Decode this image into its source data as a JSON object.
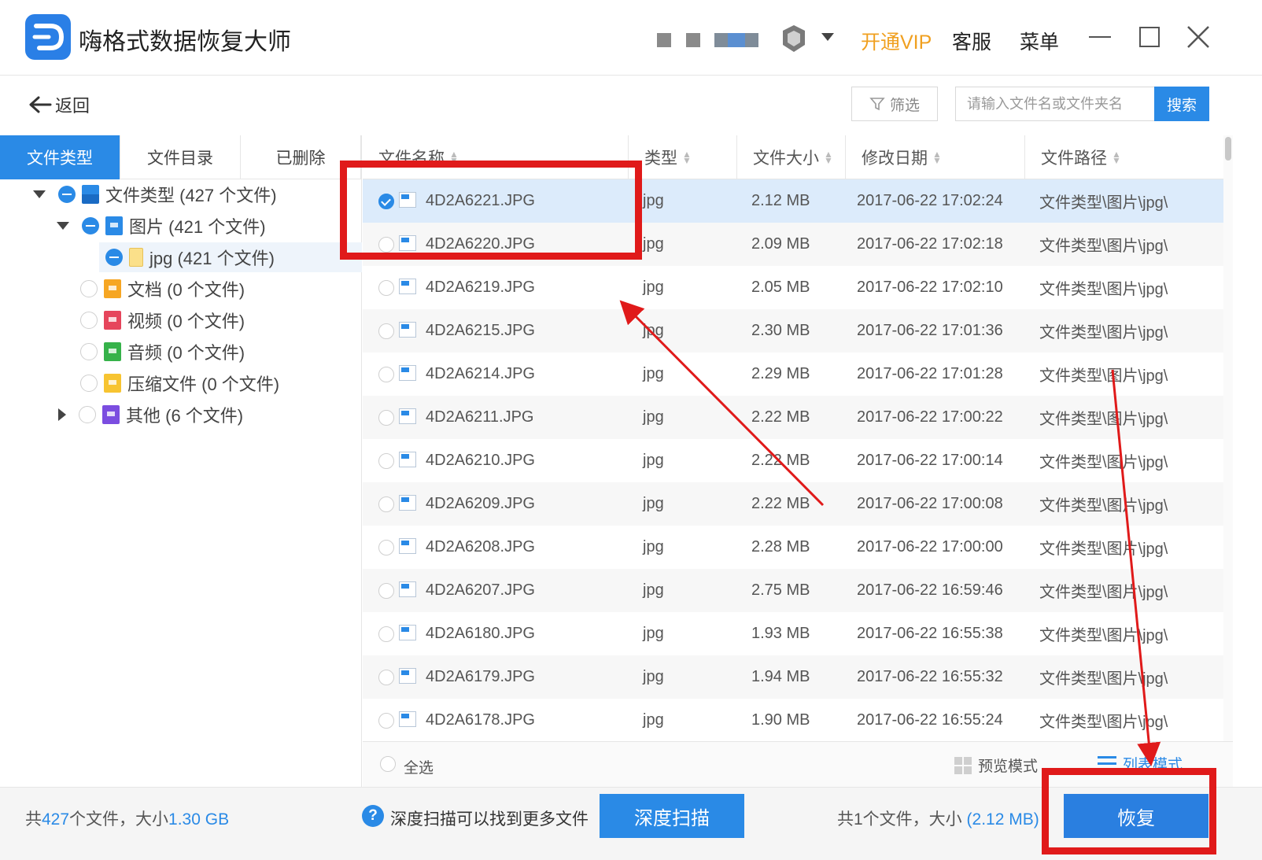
{
  "app": {
    "title": "嗨格式数据恢复大师",
    "vip_label": "开通VIP",
    "service_label": "客服",
    "menu_label": "菜单"
  },
  "toolbar": {
    "back_label": "返回",
    "filter_label": "筛选",
    "search_placeholder": "请输入文件名或文件夹名",
    "search_label": "搜索"
  },
  "tabs": [
    {
      "label": "文件类型",
      "active": true
    },
    {
      "label": "文件目录",
      "active": false
    },
    {
      "label": "已删除",
      "active": false
    }
  ],
  "tree": [
    {
      "label": "文件类型 (427 个文件)"
    },
    {
      "label": "图片 (421 个文件)"
    },
    {
      "label": "jpg (421 个文件)"
    },
    {
      "label": "文档 (0 个文件)"
    },
    {
      "label": "视频 (0 个文件)"
    },
    {
      "label": "音频 (0 个文件)"
    },
    {
      "label": "压缩文件 (0 个文件)"
    },
    {
      "label": "其他 (6 个文件)"
    }
  ],
  "table": {
    "columns": [
      "文件名称",
      "类型",
      "文件大小",
      "修改日期",
      "文件路径"
    ],
    "rows": [
      {
        "name": "4D2A6221.JPG",
        "type": "jpg",
        "size": "2.12 MB",
        "date": "2017-06-22 17:02:24",
        "path": "文件类型\\图片\\jpg\\",
        "checked": true
      },
      {
        "name": "4D2A6220.JPG",
        "type": "jpg",
        "size": "2.09 MB",
        "date": "2017-06-22 17:02:18",
        "path": "文件类型\\图片\\jpg\\",
        "checked": false
      },
      {
        "name": "4D2A6219.JPG",
        "type": "jpg",
        "size": "2.05 MB",
        "date": "2017-06-22 17:02:10",
        "path": "文件类型\\图片\\jpg\\",
        "checked": false
      },
      {
        "name": "4D2A6215.JPG",
        "type": "jpg",
        "size": "2.30 MB",
        "date": "2017-06-22 17:01:36",
        "path": "文件类型\\图片\\jpg\\",
        "checked": false
      },
      {
        "name": "4D2A6214.JPG",
        "type": "jpg",
        "size": "2.29 MB",
        "date": "2017-06-22 17:01:28",
        "path": "文件类型\\图片\\jpg\\",
        "checked": false
      },
      {
        "name": "4D2A6211.JPG",
        "type": "jpg",
        "size": "2.22 MB",
        "date": "2017-06-22 17:00:22",
        "path": "文件类型\\图片\\jpg\\",
        "checked": false
      },
      {
        "name": "4D2A6210.JPG",
        "type": "jpg",
        "size": "2.22 MB",
        "date": "2017-06-22 17:00:14",
        "path": "文件类型\\图片\\jpg\\",
        "checked": false
      },
      {
        "name": "4D2A6209.JPG",
        "type": "jpg",
        "size": "2.22 MB",
        "date": "2017-06-22 17:00:08",
        "path": "文件类型\\图片\\jpg\\",
        "checked": false
      },
      {
        "name": "4D2A6208.JPG",
        "type": "jpg",
        "size": "2.28 MB",
        "date": "2017-06-22 17:00:00",
        "path": "文件类型\\图片\\jpg\\",
        "checked": false
      },
      {
        "name": "4D2A6207.JPG",
        "type": "jpg",
        "size": "2.75 MB",
        "date": "2017-06-22 16:59:46",
        "path": "文件类型\\图片\\jpg\\",
        "checked": false
      },
      {
        "name": "4D2A6180.JPG",
        "type": "jpg",
        "size": "1.93 MB",
        "date": "2017-06-22 16:55:38",
        "path": "文件类型\\图片\\jpg\\",
        "checked": false
      },
      {
        "name": "4D2A6179.JPG",
        "type": "jpg",
        "size": "1.94 MB",
        "date": "2017-06-22 16:55:32",
        "path": "文件类型\\图片\\jpg\\",
        "checked": false
      },
      {
        "name": "4D2A6178.JPG",
        "type": "jpg",
        "size": "1.90 MB",
        "date": "2017-06-22 16:55:24",
        "path": "文件类型\\图片\\jpg\\",
        "checked": false
      }
    ]
  },
  "footer": {
    "select_all_label": "全选",
    "preview_mode_label": "预览模式",
    "list_mode_label": "列表模式"
  },
  "status": {
    "total_prefix": "共",
    "total_count": "427",
    "total_mid": "个文件，大小",
    "total_size": "1.30 GB",
    "deep_scan_tip": "深度扫描可以找到更多文件",
    "deep_scan_label": "深度扫描",
    "selected_text": "共1个文件，大小",
    "selected_size": "(2.12 MB)",
    "recover_label": "恢复"
  },
  "colors": {
    "accent": "#2a8ae6",
    "vip": "#f0a020",
    "annotation": "#e01a1a"
  }
}
